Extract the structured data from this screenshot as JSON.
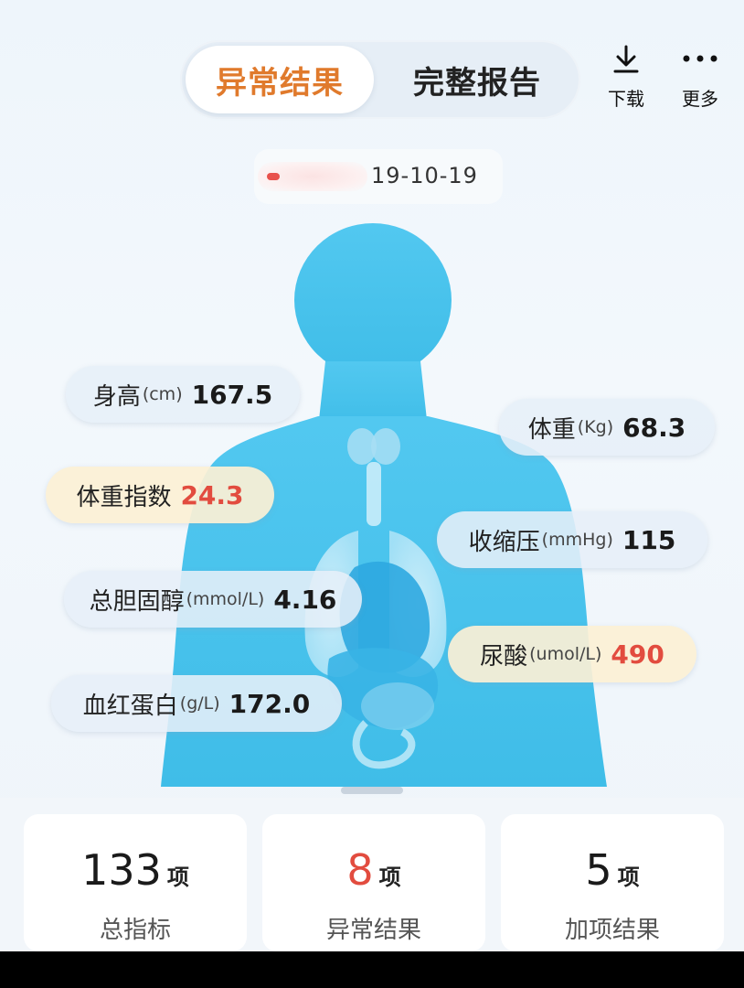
{
  "tabs": {
    "active": "异常结果",
    "other": "完整报告"
  },
  "toolbar": {
    "download_label": "下载",
    "more_label": "更多"
  },
  "report_date": "19-10-19",
  "metrics": {
    "height": {
      "name": "身高",
      "unit": "(cm)",
      "value": "167.5"
    },
    "weight": {
      "name": "体重",
      "unit": "(Kg)",
      "value": "68.3"
    },
    "bmi": {
      "name": "体重指数",
      "unit": "",
      "value": "24.3"
    },
    "systolic": {
      "name": "收缩压",
      "unit": "(mmHg)",
      "value": "115"
    },
    "cholesterol": {
      "name": "总胆固醇",
      "unit": "(mmol/L)",
      "value": "4.16"
    },
    "uric_acid": {
      "name": "尿酸",
      "unit": "(umol/L)",
      "value": "490"
    },
    "hemoglobin": {
      "name": "血红蛋白",
      "unit": "(g/L)",
      "value": "172.0"
    }
  },
  "stats": [
    {
      "count": "133",
      "unit": "项",
      "label": "总指标"
    },
    {
      "count": "8",
      "unit": "项",
      "label": "异常结果"
    },
    {
      "count": "5",
      "unit": "项",
      "label": "加项结果"
    }
  ],
  "colors": {
    "accent_orange": "#e07a2c",
    "abnormal_red": "#e24c3f",
    "body_blue": "#4cc4ec",
    "normal_pill": "#e6eff8",
    "warn_pill": "#fcf0d5"
  },
  "icons": [
    "download-icon",
    "more-icon"
  ]
}
